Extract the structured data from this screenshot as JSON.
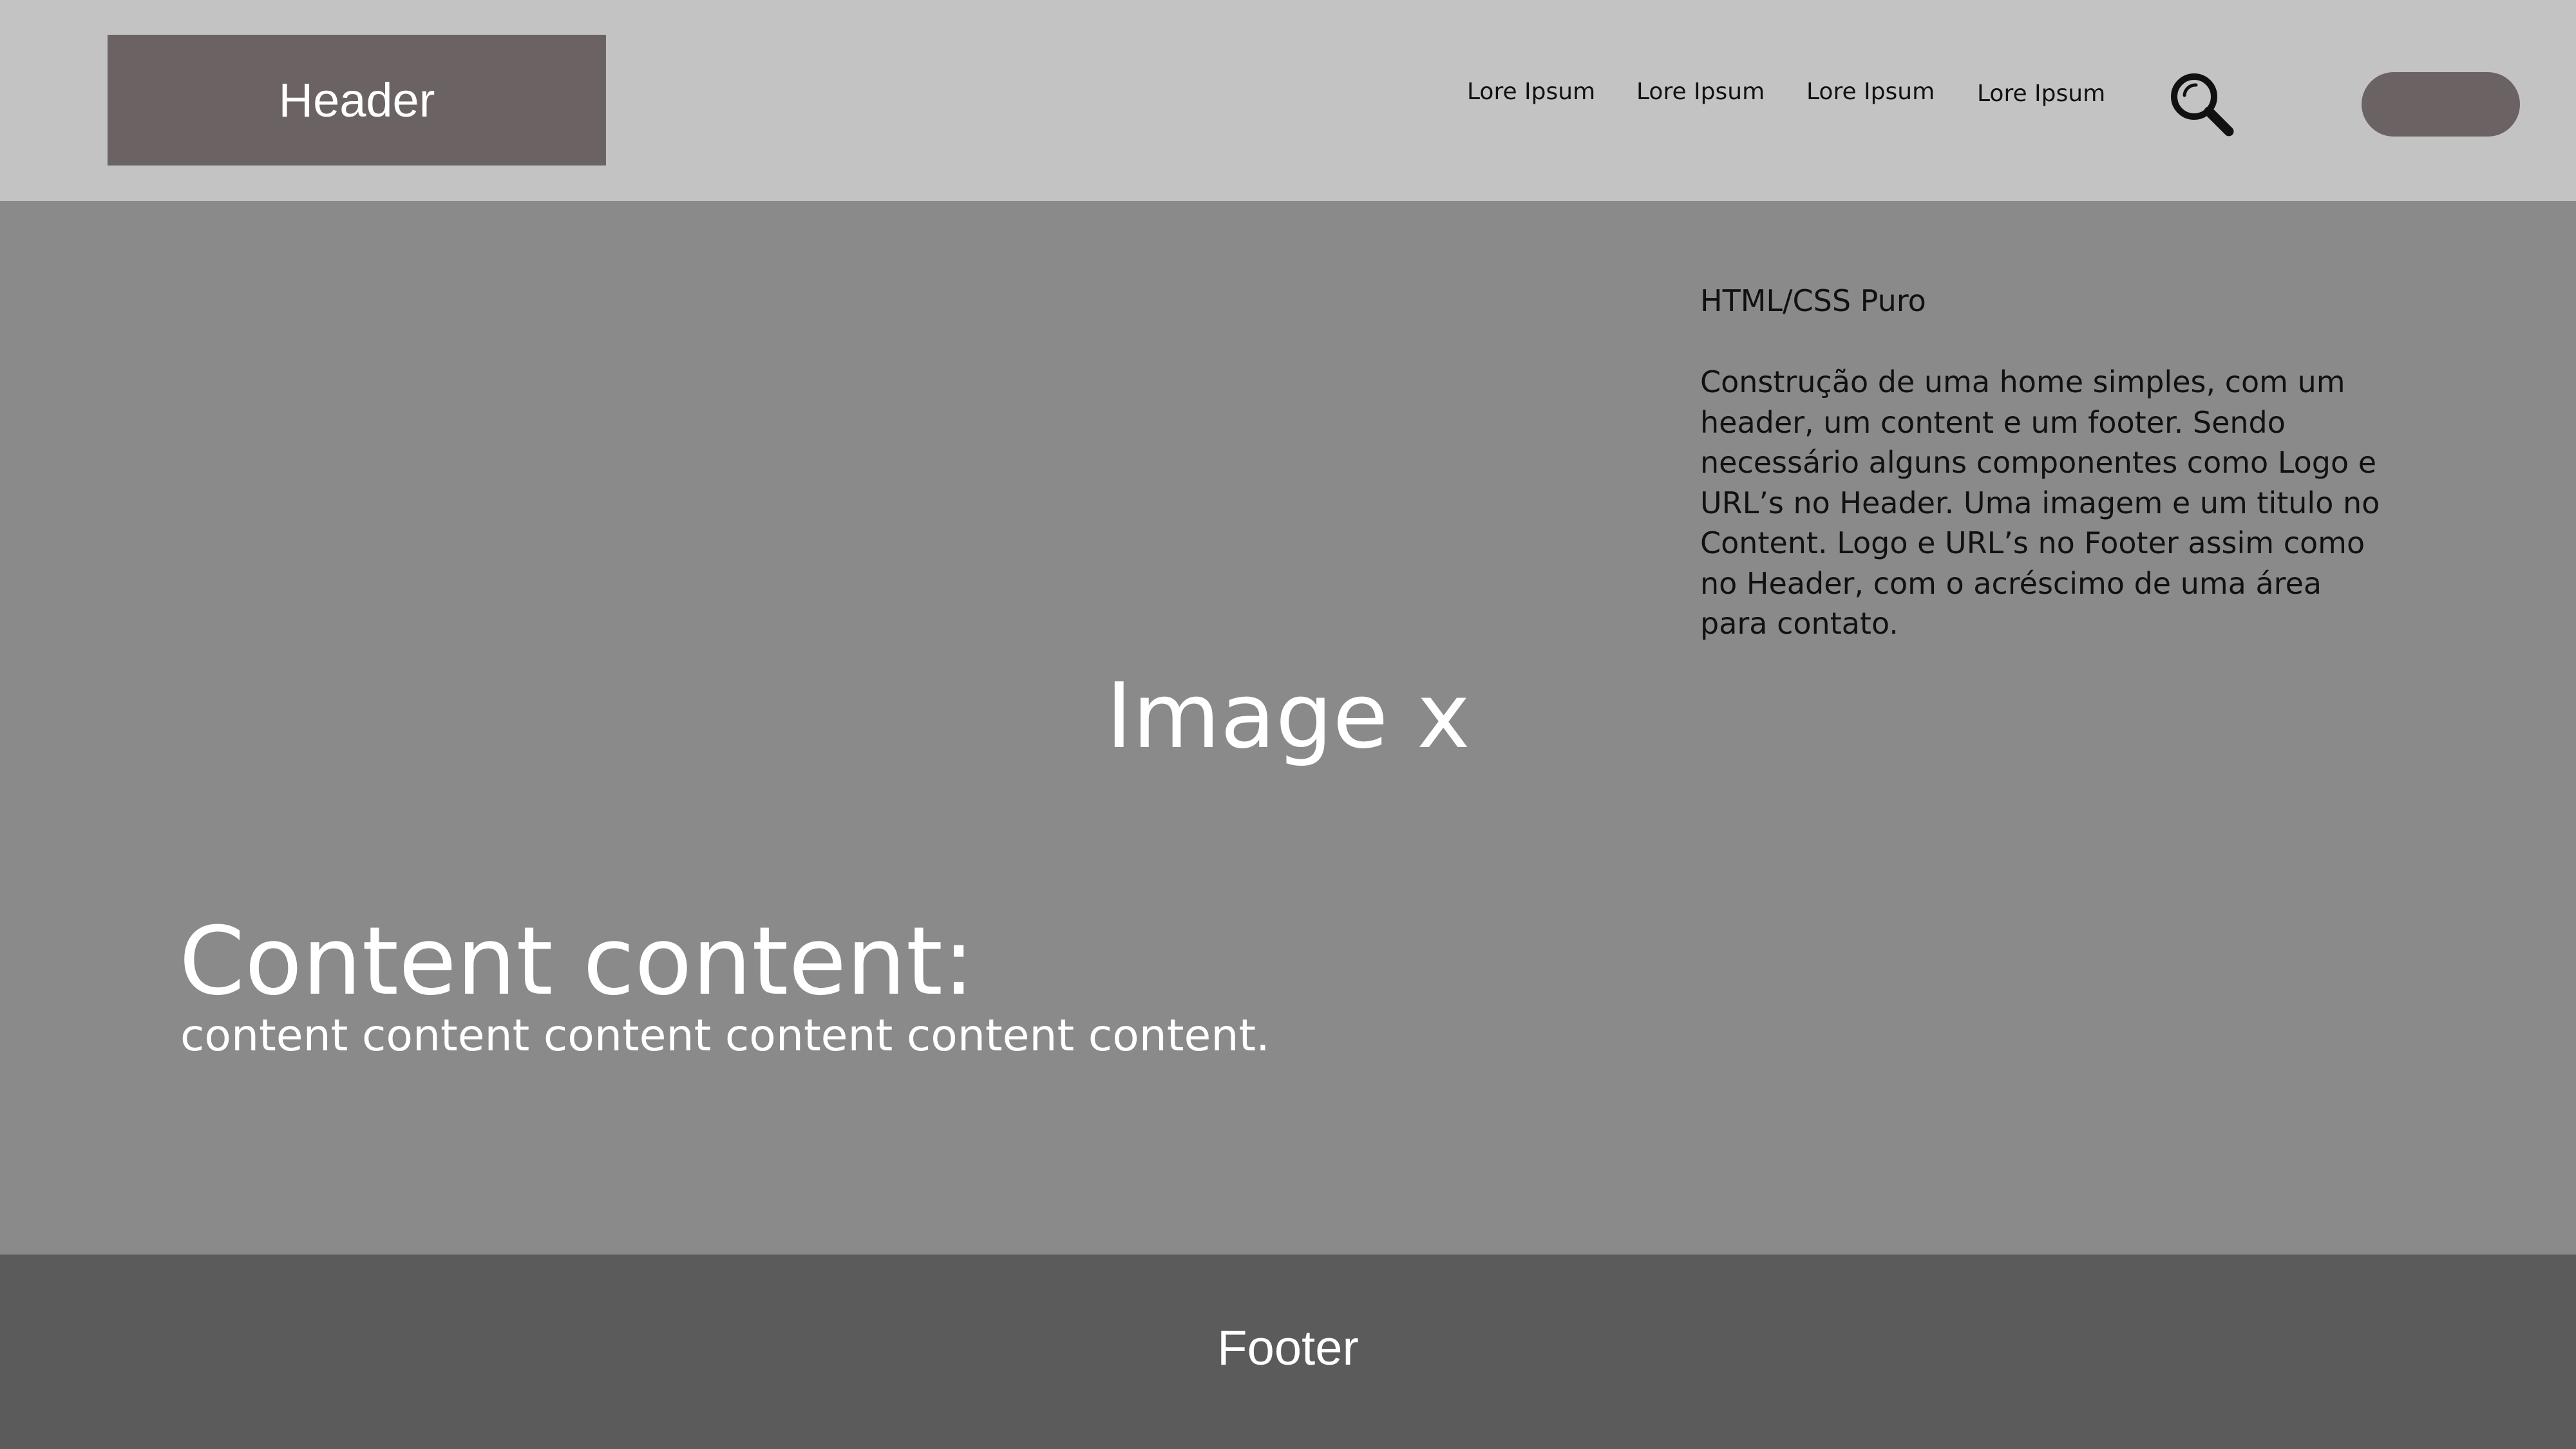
{
  "header": {
    "logo_label": "Header",
    "nav": [
      {
        "label": "Lore Ipsum"
      },
      {
        "label": "Lore Ipsum"
      },
      {
        "label": "Lore Ipsum"
      },
      {
        "label": "Lore Ipsum"
      }
    ],
    "search_icon": "search-icon",
    "background": "#c3c3c3",
    "accent": "#6b6363"
  },
  "main": {
    "image_label": "Image x",
    "description": {
      "title": "HTML/CSS Puro",
      "body": "Construção de uma home simples, com um header, um content e um footer. Sendo necessário alguns componentes como Logo e URL’s no Header. Uma imagem e um titulo no Content. Logo e URL’s no Footer assim como no Header, com o acréscimo de uma área para contato."
    },
    "heading": "Content content:",
    "text": "content content content content content content.",
    "background": "#8a8a8a"
  },
  "footer": {
    "label": "Footer",
    "background": "#5b5b5b"
  }
}
